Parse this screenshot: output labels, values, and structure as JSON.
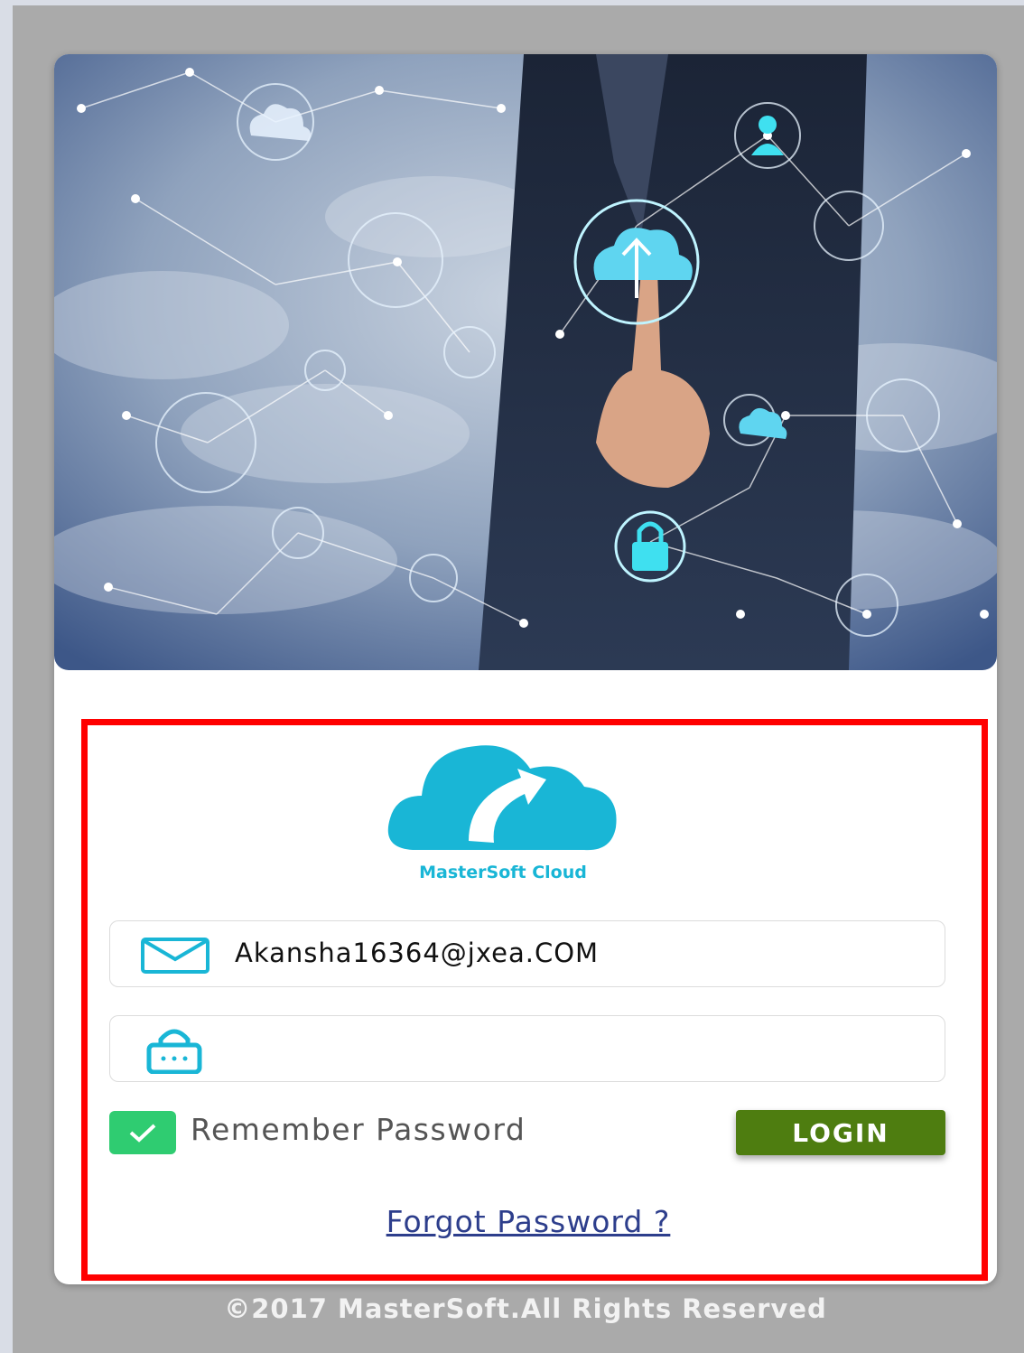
{
  "login": {
    "logo_text": "MasterSoft Cloud",
    "email_value": "Akansha16364@jxea.COM",
    "password_value": "",
    "remember_label": "Remember Password",
    "remember_checked": true,
    "login_label": "LOGIN",
    "forgot_label": "Forgot Password ?"
  },
  "footer": {
    "copyright": "©2017 MasterSoft.All Rights Reserved"
  },
  "icons": {
    "email": "envelope-icon",
    "password": "lock-icon",
    "remember": "checkmark-icon",
    "logo": "cloud-arrow-icon"
  },
  "colors": {
    "accent": "#19b6d6",
    "login_button": "#4e7d10",
    "checkbox": "#2fcc71",
    "highlight_frame": "#ff0000",
    "link": "#2d3e8c",
    "background": "#aaaaaa"
  }
}
